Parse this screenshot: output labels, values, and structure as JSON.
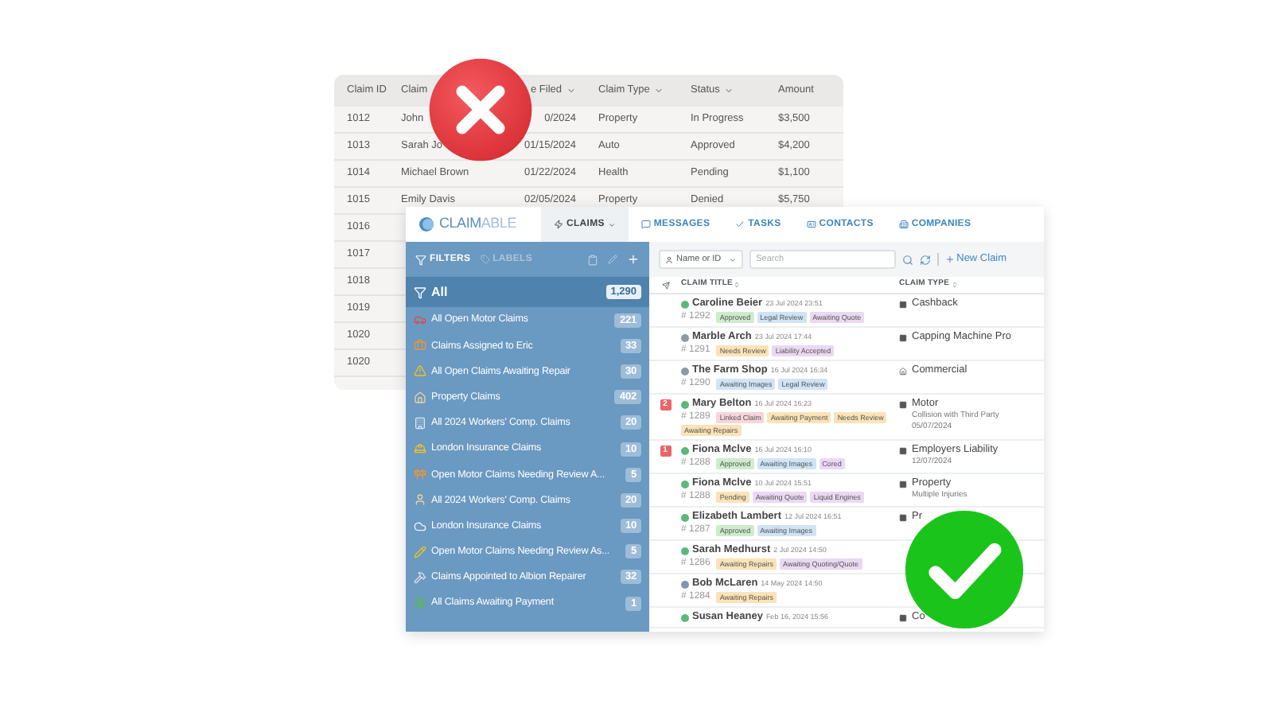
{
  "back_table": {
    "columns": [
      "Claim ID",
      "Claim",
      "e Filed",
      "Claim Type",
      "Status",
      "Amount"
    ],
    "rows": [
      [
        "1012",
        "John",
        "0/2024",
        "Property",
        "In Progress",
        "$3,500"
      ],
      [
        "1013",
        "Sarah Jo",
        "01/15/2024",
        "Auto",
        "Approved",
        "$4,200"
      ],
      [
        "1014",
        "Michael Brown",
        "01/22/2024",
        "Health",
        "Pending",
        "$1,100"
      ],
      [
        "1015",
        "Emily Davis",
        "02/05/2024",
        "Property",
        "Denied",
        "$5,750"
      ],
      [
        "1016"
      ],
      [
        "1017"
      ],
      [
        "1018"
      ],
      [
        "1019"
      ],
      [
        "1020"
      ],
      [
        "1020"
      ]
    ]
  },
  "app": {
    "logo": {
      "part_1": "CLAIM",
      "part_2": "ABLE"
    },
    "tabs": [
      {
        "label": "CLAIMS",
        "selected": true
      },
      {
        "label": "MESSAGES",
        "selected": false
      },
      {
        "label": "TASKS",
        "selected": false
      },
      {
        "label": "CONTACTS",
        "selected": false
      },
      {
        "label": "COMPANIES",
        "selected": false
      }
    ],
    "sidebar": {
      "filters_label": "FILTERS",
      "labels_label": "LABELS",
      "items": [
        {
          "label": "All",
          "count": "1,290",
          "selected": true
        },
        {
          "label": "All Open Motor Claims",
          "count": "221",
          "selected": false
        },
        {
          "label": "Claims Assigned to Eric",
          "count": "33",
          "selected": false
        },
        {
          "label": "All Open Claims Awaiting Repair",
          "count": "30",
          "selected": false
        },
        {
          "label": "Property Claims",
          "count": "402",
          "selected": false
        },
        {
          "label": "All 2024 Workers' Comp. Claims",
          "count": "20",
          "selected": false
        },
        {
          "label": "London Insurance Claims",
          "count": "10",
          "selected": false
        },
        {
          "label": "Open Motor Claims Needing Review A...",
          "count": "5",
          "selected": false
        },
        {
          "label": "All 2024 Workers' Comp. Claims",
          "count": "20",
          "selected": false
        },
        {
          "label": "London Insurance Claims",
          "count": "10",
          "selected": false
        },
        {
          "label": "Open Motor Claims Needing Review As...",
          "count": "5",
          "selected": false
        },
        {
          "label": "Claims Appointed to Albion Repairer",
          "count": "32",
          "selected": false
        },
        {
          "label": "All Claims Awaiting Payment",
          "count": "1",
          "selected": false
        }
      ]
    },
    "toolbar": {
      "search_mode": "Name or ID",
      "search_placeholder": "Search",
      "new_button": "New Claim"
    },
    "columns": [
      "CLAIM TITLE",
      "CLAIM TYPE"
    ],
    "claims": [
      {
        "name": "Caroline Beier",
        "date": "23 Jul 2024 23:51",
        "id": "# 1292",
        "color": "#5cb87a",
        "tags": [
          {
            "label": "Approved",
            "color": "#cdeccb"
          },
          {
            "label": "Legal Review",
            "color": "#cfe4f5"
          },
          {
            "label": "Awaiting Quote",
            "color": "#ead9f3"
          }
        ],
        "type": "Cashback"
      },
      {
        "name": "Marble Arch",
        "date": "23 Jul 2024 17:44",
        "id": "# 1291",
        "color": "#8c9aa6",
        "tags": [
          {
            "label": "Needs Review",
            "color": "#fbe3b8"
          },
          {
            "label": "Liability Accepted",
            "color": "#ead9f3"
          }
        ],
        "type": "Capping Machine Pro"
      },
      {
        "name": "The Farm Shop",
        "date": "16 Jul 2024 16:34",
        "id": "# 1290",
        "color": "#8c9aa6",
        "tags": [
          {
            "label": "Awaiting Images",
            "color": "#cfe4f5"
          },
          {
            "label": "Legal Review",
            "color": "#cfe4f5"
          }
        ],
        "type": "Commercial"
      },
      {
        "flag": "2",
        "name": "Mary Belton",
        "date": "16 Jul 2024 16:23",
        "id": "# 1289",
        "color": "#5cb87a",
        "tags": [
          {
            "label": "Linked Claim",
            "color": "#f8d4dc"
          },
          {
            "label": "Awaiting Payment",
            "color": "#fbe3b8"
          },
          {
            "label": "Needs Review",
            "color": "#fbe3b8"
          },
          {
            "label": "Awaiting Repairs",
            "color": "#fbe3b8"
          }
        ],
        "type": "Motor",
        "type_details": [
          "Collision with Third Party",
          "05/07/2024"
        ]
      },
      {
        "flag": "1",
        "name": "Fiona Mclve",
        "date": "16 Jul 2024 16:10",
        "id": "# 1288",
        "color": "#5cb87a",
        "tags": [
          {
            "label": "Approved",
            "color": "#cdeccb"
          },
          {
            "label": "Awaiting Images",
            "color": "#cfe4f5"
          },
          {
            "label": "Cored",
            "color": "#ead9f3"
          }
        ],
        "type": "Employers Liability",
        "type_details": [
          "12/07/2024"
        ]
      },
      {
        "name": "Fiona Mclve",
        "date": "10 Jul 2024 15:51",
        "id": "# 1288",
        "color": "#5cb87a",
        "tags": [
          {
            "label": "Pending",
            "color": "#fbe3b8"
          },
          {
            "label": "Awaiting Quote",
            "color": "#ead9f3"
          },
          {
            "label": "Liquid Engines",
            "color": "#ead9f3"
          }
        ],
        "type": "Property",
        "type_details": [
          "Multiple Injuries"
        ]
      },
      {
        "name": "Elizabeth Lambert",
        "date": "12 Jul 2024 16:51",
        "id": "# 1287",
        "color": "#5cb87a",
        "tags": [
          {
            "label": "Approved",
            "color": "#cdeccb"
          },
          {
            "label": "Awaiting Images",
            "color": "#cfe4f5"
          }
        ],
        "type": "Pr"
      },
      {
        "name": "Sarah Medhurst",
        "date": "2 Jul 2024 14:50",
        "id": "# 1286",
        "color": "#5cb87a",
        "tags": [
          {
            "label": "Awaiting Repairs",
            "color": "#fbe3b8"
          },
          {
            "label": "Awaiting Quoting/Quote",
            "color": "#ead9f3"
          }
        ]
      },
      {
        "name": "Bob McLaren",
        "date": "14 May 2024 14:50",
        "id": "# 1284",
        "color": "#7f97ad",
        "tags": [
          {
            "label": "Awaiting Repairs",
            "color": "#fbe3b8"
          }
        ]
      },
      {
        "name": "Susan Heaney",
        "date": "Feb 16, 2024 15:56",
        "color": "#5cb87a",
        "type": "Co"
      }
    ]
  }
}
